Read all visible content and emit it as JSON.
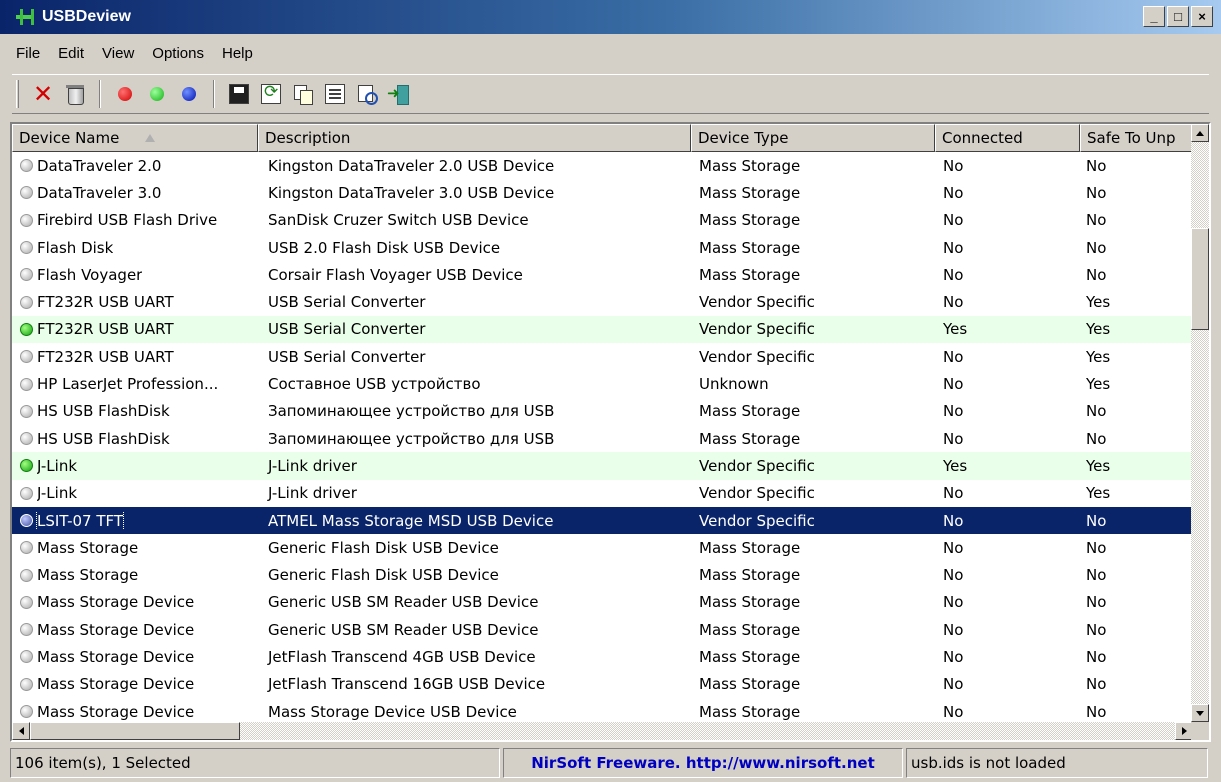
{
  "window": {
    "title": "USBDeview",
    "min": "_",
    "max": "□",
    "close": "×"
  },
  "menu": [
    "File",
    "Edit",
    "View",
    "Options",
    "Help"
  ],
  "columns": [
    "Device Name",
    "Description",
    "Device Type",
    "Connected",
    "Safe To Unp"
  ],
  "rows": [
    {
      "name": "DataTraveler 2.0",
      "desc": "Kingston DataTraveler 2.0 USB Device",
      "type": "Mass Storage",
      "connected": "No",
      "safe": "No",
      "state": "off"
    },
    {
      "name": "DataTraveler 3.0",
      "desc": "Kingston DataTraveler 3.0 USB Device",
      "type": "Mass Storage",
      "connected": "No",
      "safe": "No",
      "state": "off"
    },
    {
      "name": "Firebird USB Flash Drive",
      "desc": "SanDisk Cruzer Switch USB Device",
      "type": "Mass Storage",
      "connected": "No",
      "safe": "No",
      "state": "off"
    },
    {
      "name": "Flash Disk",
      "desc": "USB 2.0 Flash Disk USB Device",
      "type": "Mass Storage",
      "connected": "No",
      "safe": "No",
      "state": "off"
    },
    {
      "name": "Flash Voyager",
      "desc": "Corsair Flash Voyager USB Device",
      "type": "Mass Storage",
      "connected": "No",
      "safe": "No",
      "state": "off"
    },
    {
      "name": "FT232R USB UART",
      "desc": "USB Serial Converter",
      "type": "Vendor Specific",
      "connected": "No",
      "safe": "Yes",
      "state": "off"
    },
    {
      "name": "FT232R USB UART",
      "desc": "USB Serial Converter",
      "type": "Vendor Specific",
      "connected": "Yes",
      "safe": "Yes",
      "state": "on"
    },
    {
      "name": "FT232R USB UART",
      "desc": "USB Serial Converter",
      "type": "Vendor Specific",
      "connected": "No",
      "safe": "Yes",
      "state": "off"
    },
    {
      "name": "HP LaserJet Profession...",
      "desc": "Составное USB устройство",
      "type": "Unknown",
      "connected": "No",
      "safe": "Yes",
      "state": "off"
    },
    {
      "name": "HS USB FlashDisk",
      "desc": "Запоминающее устройство для USB",
      "type": "Mass Storage",
      "connected": "No",
      "safe": "No",
      "state": "off"
    },
    {
      "name": "HS USB FlashDisk",
      "desc": "Запоминающее устройство для USB",
      "type": "Mass Storage",
      "connected": "No",
      "safe": "No",
      "state": "off"
    },
    {
      "name": "J-Link",
      "desc": "J-Link driver",
      "type": "Vendor Specific",
      "connected": "Yes",
      "safe": "Yes",
      "state": "on"
    },
    {
      "name": "J-Link",
      "desc": "J-Link driver",
      "type": "Vendor Specific",
      "connected": "No",
      "safe": "Yes",
      "state": "off"
    },
    {
      "name": "LSIT-07 TFT",
      "desc": "ATMEL Mass Storage MSD USB Device",
      "type": "Vendor Specific",
      "connected": "No",
      "safe": "No",
      "state": "selected"
    },
    {
      "name": "Mass Storage",
      "desc": "Generic Flash Disk USB Device",
      "type": "Mass Storage",
      "connected": "No",
      "safe": "No",
      "state": "off"
    },
    {
      "name": "Mass Storage",
      "desc": "Generic Flash Disk USB Device",
      "type": "Mass Storage",
      "connected": "No",
      "safe": "No",
      "state": "off"
    },
    {
      "name": "Mass Storage Device",
      "desc": "Generic USB SM Reader USB Device",
      "type": "Mass Storage",
      "connected": "No",
      "safe": "No",
      "state": "off"
    },
    {
      "name": "Mass Storage Device",
      "desc": "Generic USB SM Reader USB Device",
      "type": "Mass Storage",
      "connected": "No",
      "safe": "No",
      "state": "off"
    },
    {
      "name": "Mass Storage Device",
      "desc": "JetFlash Transcend 4GB USB Device",
      "type": "Mass Storage",
      "connected": "No",
      "safe": "No",
      "state": "off"
    },
    {
      "name": "Mass Storage Device",
      "desc": "JetFlash Transcend 16GB USB Device",
      "type": "Mass Storage",
      "connected": "No",
      "safe": "No",
      "state": "off"
    },
    {
      "name": "Mass Storage Device",
      "desc": "Mass Storage Device USB Device",
      "type": "Mass Storage",
      "connected": "No",
      "safe": "No",
      "state": "off"
    }
  ],
  "status": {
    "count": "106 item(s), 1 Selected",
    "link": "NirSoft Freeware.  http://www.nirsoft.net",
    "ids": "usb.ids is not loaded"
  },
  "colors": {
    "selected_bg": "#0a246a",
    "connected_bg": "#eaffea",
    "link": "#0000c0"
  }
}
